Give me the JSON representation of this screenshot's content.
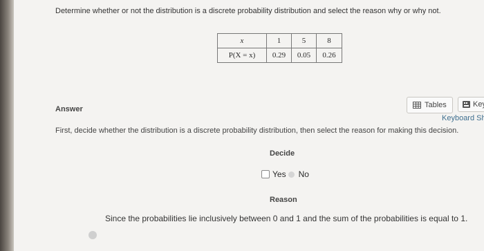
{
  "question": "Determine whether or not the distribution is a discrete probability distribution and select the reason why or why not.",
  "table": {
    "x_label": "x",
    "p_label": "P(X = x)",
    "x_values": [
      "1",
      "5",
      "8"
    ],
    "p_values": [
      "0.29",
      "0.05",
      "0.26"
    ]
  },
  "answer_label": "Answer",
  "toolbar": {
    "tables_label": "Tables",
    "keypad_label": "Key",
    "shortcuts_label": "Keyboard Sho"
  },
  "instruction": "First, decide whether the distribution is a discrete probability distribution, then select the reason for making this decision.",
  "decide": {
    "label": "Decide",
    "yes_label": "Yes",
    "no_label": "No"
  },
  "reason": {
    "label": "Reason",
    "option_text": "Since the probabilities lie inclusively between 0 and 1 and the sum of the probabilities is equal to 1."
  }
}
